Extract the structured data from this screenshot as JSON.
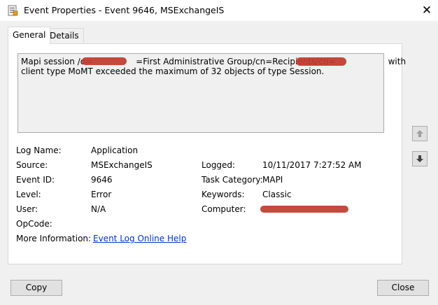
{
  "window": {
    "title": "Event Properties - Event 9646, MSExchangeIS",
    "close_glyph": "✕"
  },
  "tabs": [
    {
      "label": "General",
      "active": true
    },
    {
      "label": "Details",
      "active": false
    }
  ],
  "description": {
    "line1_a": "Mapi session /o=",
    "line1_b": "=First Administrative Group/cn=Recipients/cn=",
    "line1_c": "with",
    "line2": "client type MoMT exceeded the maximum of 32 objects of type Session."
  },
  "fields": {
    "log_name": {
      "label": "Log Name:",
      "value": "Application"
    },
    "source": {
      "label": "Source:",
      "value": "MSExchangeIS"
    },
    "event_id": {
      "label": "Event ID:",
      "value": "9646"
    },
    "level": {
      "label": "Level:",
      "value": "Error"
    },
    "user": {
      "label": "User:",
      "value": "N/A"
    },
    "opcode": {
      "label": "OpCode:",
      "value": ""
    },
    "more_info": {
      "label": "More Information:",
      "link": "Event Log Online Help"
    },
    "logged": {
      "label": "Logged:",
      "value": "10/11/2017 7:27:52 AM"
    },
    "task_category": {
      "label": "Task Category:",
      "value": "MAPI"
    },
    "keywords": {
      "label": "Keywords:",
      "value": "Classic"
    },
    "computer": {
      "label": "Computer:",
      "value": ""
    }
  },
  "buttons": {
    "copy": "Copy",
    "close": "Close"
  },
  "colors": {
    "redaction": "#c0392b",
    "link": "#0033cc"
  },
  "icons": {
    "app": "event-properties-icon",
    "up": "arrow-up-icon",
    "down": "arrow-down-icon"
  }
}
